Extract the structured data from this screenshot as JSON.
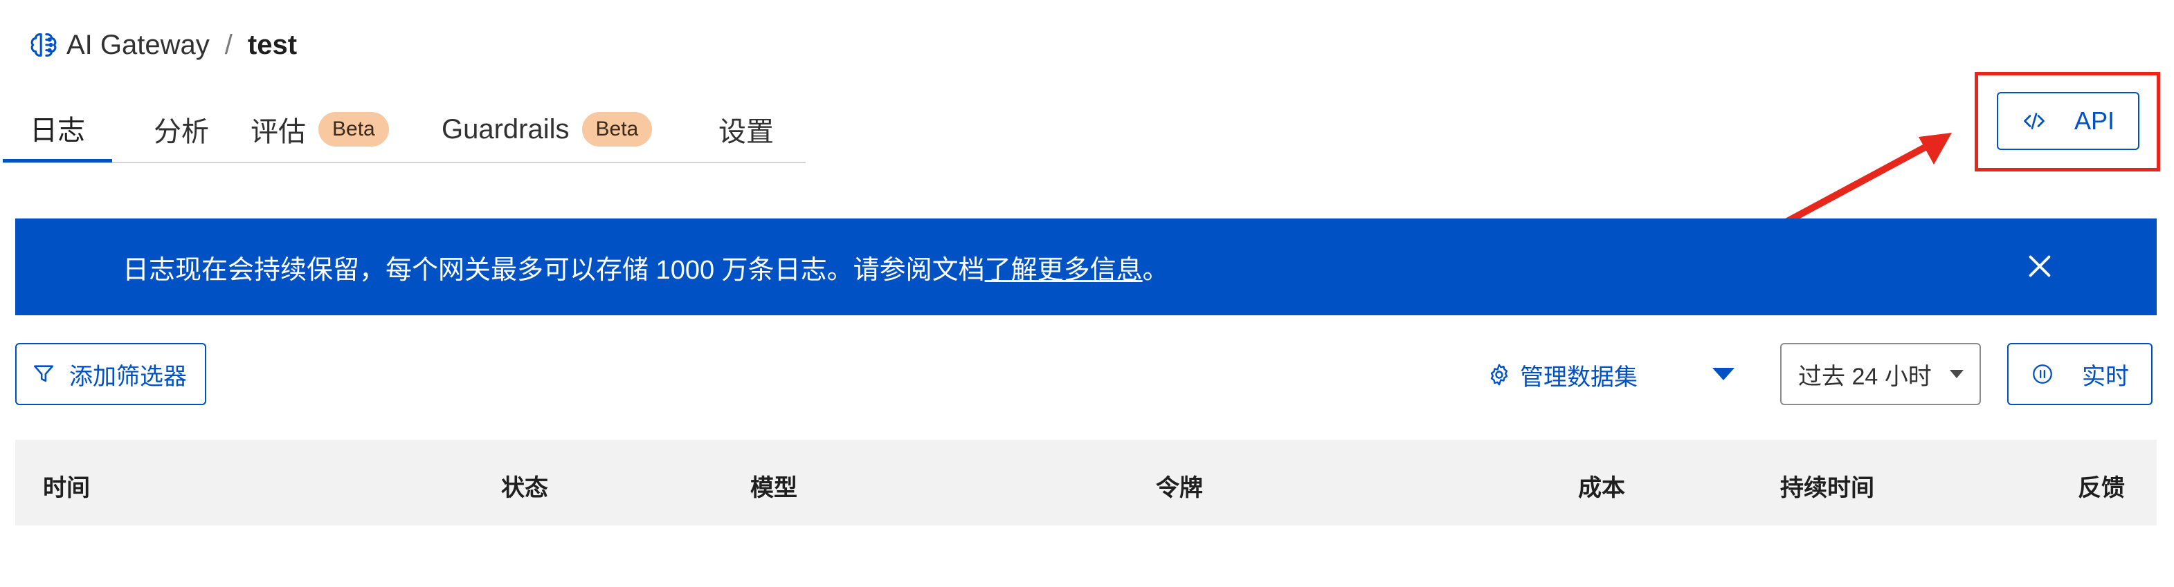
{
  "breadcrumb": {
    "icon": "ai-brain-icon",
    "root": "AI Gateway",
    "separator": "/",
    "current": "test"
  },
  "tabs": [
    {
      "label": "日志",
      "active": true
    },
    {
      "label": "分析"
    },
    {
      "label": "评估",
      "badge": "Beta"
    },
    {
      "label": "Guardrails",
      "badge": "Beta"
    },
    {
      "label": "设置"
    }
  ],
  "api_button": {
    "label": "API",
    "icon": "code-icon"
  },
  "banner": {
    "message": "日志现在会持续保留，每个网关最多可以存储 1000 万条日志。请参阅文档",
    "link_text": "了解更多信息",
    "suffix": "。",
    "close_icon": "close-icon"
  },
  "toolbar": {
    "filter_label": "添加筛选器",
    "manage_label": "管理数据集",
    "time_range": "过去 24 小时",
    "live_label": "实时"
  },
  "table": {
    "columns": [
      "时间",
      "状态",
      "模型",
      "令牌",
      "成本",
      "持续时间",
      "反馈"
    ]
  },
  "colors": {
    "accent": "#0051c3",
    "badge_bg": "#f8c8a0",
    "annotation_red": "#e8271c",
    "header_bg": "#f2f2f2"
  }
}
